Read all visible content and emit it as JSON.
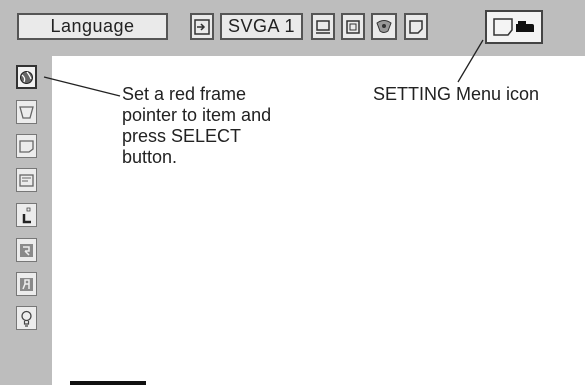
{
  "menu_bar": {
    "language_label": "Language",
    "source_label": "SVGA 1",
    "icons": [
      "input-icon",
      "image-adjust-icon",
      "screen-icon",
      "sound-icon",
      "pc-adjust-icon",
      "setting-icon"
    ]
  },
  "sidebar": {
    "items": [
      "language-icon",
      "keystone-icon",
      "blue-back-icon",
      "display-icon",
      "logo-icon",
      "ceiling-icon",
      "rear-icon",
      "lamp-icon"
    ]
  },
  "annotations": {
    "left_note": "Set a red frame pointer to item and press SELECT button.",
    "right_note": "SETTING Menu icon"
  },
  "colors": {
    "bar_bg": "#bdbdbd",
    "box_bg": "#eaeaea"
  }
}
